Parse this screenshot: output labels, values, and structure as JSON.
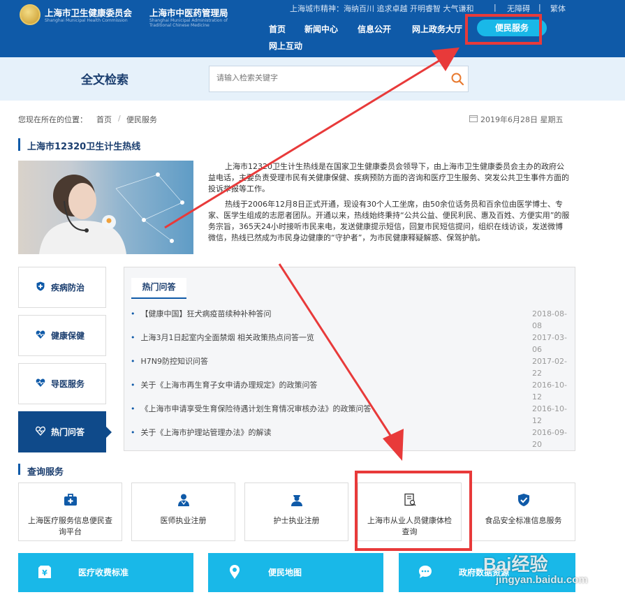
{
  "header": {
    "org_name": "上海市卫生健康委员会",
    "org_name_en": "Shanghai Municipal Health Commission",
    "admin_name": "上海市中医药管理局",
    "admin_name_en": "Shanghai Municipal Administration of Traditional Chinese Medicine",
    "spirit": "上海城市精神：海纳百川 追求卓越 开明睿智 大气谦和",
    "accessibility_link": "无障碍",
    "traditional_link": "繁体"
  },
  "nav": {
    "items": [
      "首页",
      "新闻中心",
      "信息公开",
      "网上政务大厅",
      "便民服务",
      "网上互动"
    ],
    "active": "便民服务"
  },
  "search": {
    "title": "全文检索",
    "placeholder": "请输入检索关键字"
  },
  "breadcrumb": {
    "prefix": "您现在所在的位置：",
    "home": "首页",
    "separator": "/",
    "current": "便民服务"
  },
  "date": "2019年6月28日 星期五",
  "hotline": {
    "title": "上海市12320卫生计生热线",
    "para1": "上海市12320卫生计生热线是在国家卫生健康委员会领导下，由上海市卫生健康委员会主办的政府公益电话，主要负责受理市民有关健康保健、疾病预防方面的咨询和医疗卫生服务、突发公共卫生事件方面的投诉举报等工作。",
    "para2": "热线于2006年12月8日正式开通，现设有30个人工坐席，由50余位话务员和百余位由医学博士、专家、医学生组成的志愿者团队。开通以来，热线始终秉持“公共公益、便民利民、惠及百姓、方便实用”的服务宗旨，365天24小时接听市民来电，发送健康提示短信，回复市民短信提问，组织在线访谈，发送微博微信，热线已然成为市民身边健康的“守护者”，为市民健康释疑解惑、保驾护航。"
  },
  "side_tabs": [
    "疾病防治",
    "健康保健",
    "导医服务",
    "热门问答"
  ],
  "qa": {
    "tab": "热门问答",
    "items": [
      {
        "title": "【健康中国】狂犬病疫苗续种补种答问",
        "date": "2018-08-08"
      },
      {
        "title": "上海3月1日起室内全面禁烟 相关政策热点问答一览",
        "date": "2017-03-06"
      },
      {
        "title": "H7N9防控知识问答",
        "date": "2017-02-22"
      },
      {
        "title": "关于《上海市再生育子女申请办理规定》的政策问答",
        "date": "2016-10-12"
      },
      {
        "title": "《上海市申请享受生育保险待遇计划生育情况审核办法》的政策问答",
        "date": "2016-10-12"
      },
      {
        "title": "关于《上海市护理站管理办法》的解读",
        "date": "2016-09-20"
      }
    ]
  },
  "query": {
    "title": "查询服务",
    "cards": [
      "上海医疗服务信息便民查询平台",
      "医师执业注册",
      "护士执业注册",
      "上海市从业人员健康体检查询",
      "食品安全标准信息服务"
    ]
  },
  "bottom_cards": [
    "医疗收费标准",
    "便民地图",
    "政府数据资源"
  ],
  "watermark": {
    "brand": "Bai经验",
    "url": "jingyan.baidu.com"
  },
  "colors": {
    "brand": "#0f5aa8",
    "accent": "#19b8e8",
    "annotation": "#e83a3a",
    "panel": "#f5f6f8"
  }
}
